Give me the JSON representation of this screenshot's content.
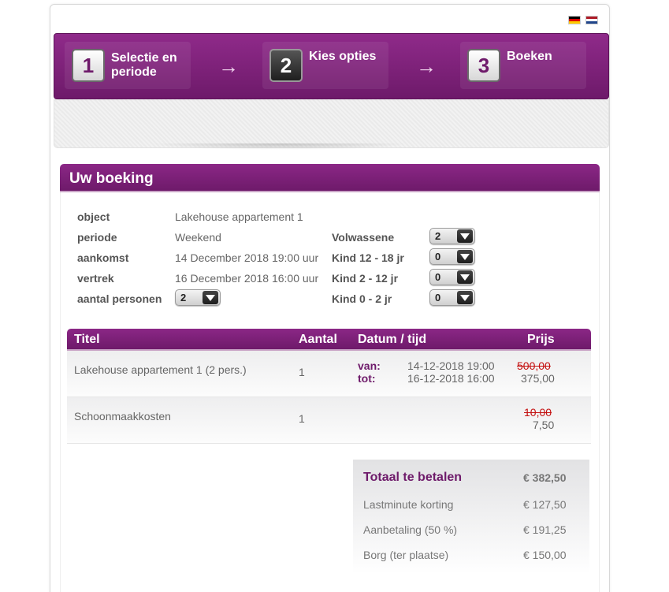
{
  "languages": [
    {
      "code": "de",
      "icon": "german-flag-icon"
    },
    {
      "code": "nl",
      "icon": "dutch-flag-icon"
    }
  ],
  "steps": [
    {
      "number": "1",
      "label": "Selectie en periode",
      "active": false
    },
    {
      "number": "2",
      "label": "Kies opties",
      "active": true
    },
    {
      "number": "3",
      "label": "Boeken",
      "active": false
    }
  ],
  "step_arrow_glyph": "→",
  "booking": {
    "title": "Uw boeking",
    "object_label": "object",
    "object_value": "Lakehouse appartement 1",
    "periode_label": "periode",
    "periode_value": "Weekend",
    "aankomst_label": "aankomst",
    "aankomst_value": "14 December 2018 19:00 uur",
    "vertrek_label": "vertrek",
    "vertrek_value": "16 December 2018 16:00 uur",
    "personen_label": "aantal personen",
    "personen_value": "2",
    "guests": [
      {
        "label": "Volwassene",
        "value": "2"
      },
      {
        "label": "Kind 12 - 18 jr",
        "value": "0"
      },
      {
        "label": "Kind 2 - 12 jr",
        "value": "0"
      },
      {
        "label": "Kind 0 - 2 jr",
        "value": "0"
      }
    ]
  },
  "table": {
    "headers": {
      "titel": "Titel",
      "aantal": "Aantal",
      "datum": "Datum / tijd",
      "prijs": "Prijs"
    },
    "rows": [
      {
        "titel": "Lakehouse appartement 1 (2 pers.)",
        "aantal": "1",
        "van_label": "van:",
        "van_value": "14-12-2018 19:00",
        "tot_label": "tot:",
        "tot_value": "16-12-2018 16:00",
        "old_price": "500,00",
        "price": "375,00"
      },
      {
        "titel": "Schoonmaakkosten",
        "aantal": "1",
        "old_price": "10,00",
        "price": "7,50"
      }
    ]
  },
  "totals": {
    "total_label": "Totaal te betalen",
    "total_value": "€ 382,50",
    "discount_label": "Lastminute korting",
    "discount_value": "€ 127,50",
    "deposit_label": "Aanbetaling (50 %)",
    "deposit_value": "€ 191,25",
    "borg_label": "Borg (ter plaatse)",
    "borg_value": "€ 150,00"
  },
  "colors": {
    "brand": "#6e1a6a",
    "strike": "#c41010"
  }
}
